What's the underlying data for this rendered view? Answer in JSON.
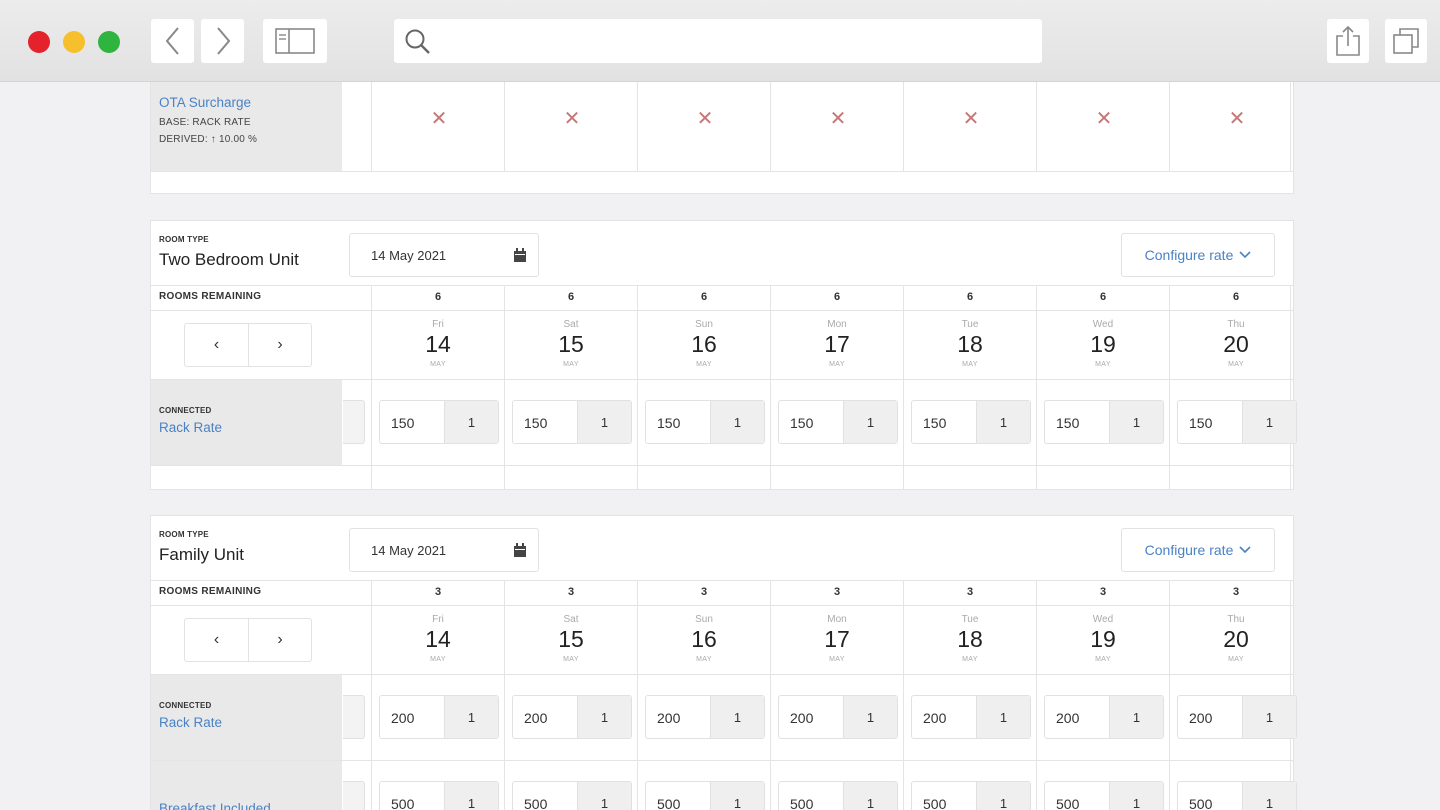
{
  "browser": {
    "back_icon": "chevron-left-icon",
    "forward_icon": "chevron-right-icon",
    "sidebar_icon": "sidebar-icon",
    "search_icon": "search-icon",
    "share_icon": "share-icon",
    "tabs_icon": "tabs-icon"
  },
  "top_card": {
    "rate_name": "OTA Surcharge",
    "base": "BASE: RACK RATE",
    "derived": "DERIVED: ↑ 10.00 %",
    "cells": [
      "✕",
      "✕",
      "✕",
      "✕",
      "✕",
      "✕",
      "✕"
    ]
  },
  "room_cards": [
    {
      "room_type_label": "ROOM TYPE",
      "room_type": "Two Bedroom Unit",
      "date": "14 May 2021",
      "configure_label": "Configure rate",
      "rooms_remaining_label": "ROOMS REMAINING",
      "remaining": [
        "6",
        "6",
        "6",
        "6",
        "6",
        "6",
        "6"
      ],
      "days": [
        {
          "name": "Fri",
          "num": "14",
          "mon": "MAY"
        },
        {
          "name": "Sat",
          "num": "15",
          "mon": "MAY"
        },
        {
          "name": "Sun",
          "num": "16",
          "mon": "MAY"
        },
        {
          "name": "Mon",
          "num": "17",
          "mon": "MAY"
        },
        {
          "name": "Tue",
          "num": "18",
          "mon": "MAY"
        },
        {
          "name": "Wed",
          "num": "19",
          "mon": "MAY"
        },
        {
          "name": "Thu",
          "num": "20",
          "mon": "MAY"
        }
      ],
      "pager_prev": "‹",
      "pager_next": "›",
      "rates": [
        {
          "tag": "CONNECTED",
          "name": "Rack Rate",
          "values": [
            "150",
            "150",
            "150",
            "150",
            "150",
            "150",
            "150"
          ],
          "qty": [
            "1",
            "1",
            "1",
            "1",
            "1",
            "1",
            "1"
          ]
        }
      ]
    },
    {
      "room_type_label": "ROOM TYPE",
      "room_type": "Family Unit",
      "date": "14 May 2021",
      "configure_label": "Configure rate",
      "rooms_remaining_label": "ROOMS REMAINING",
      "remaining": [
        "3",
        "3",
        "3",
        "3",
        "3",
        "3",
        "3"
      ],
      "days": [
        {
          "name": "Fri",
          "num": "14",
          "mon": "MAY"
        },
        {
          "name": "Sat",
          "num": "15",
          "mon": "MAY"
        },
        {
          "name": "Sun",
          "num": "16",
          "mon": "MAY"
        },
        {
          "name": "Mon",
          "num": "17",
          "mon": "MAY"
        },
        {
          "name": "Tue",
          "num": "18",
          "mon": "MAY"
        },
        {
          "name": "Wed",
          "num": "19",
          "mon": "MAY"
        },
        {
          "name": "Thu",
          "num": "20",
          "mon": "MAY"
        }
      ],
      "pager_prev": "‹",
      "pager_next": "›",
      "rates": [
        {
          "tag": "CONNECTED",
          "name": "Rack Rate",
          "values": [
            "200",
            "200",
            "200",
            "200",
            "200",
            "200",
            "200"
          ],
          "qty": [
            "1",
            "1",
            "1",
            "1",
            "1",
            "1",
            "1"
          ]
        },
        {
          "tag": "",
          "name": "Breakfast Included",
          "values": [
            "500",
            "500",
            "500",
            "500",
            "500",
            "500",
            "500"
          ],
          "qty": [
            "1",
            "1",
            "1",
            "1",
            "1",
            "1",
            "1"
          ]
        }
      ]
    }
  ]
}
